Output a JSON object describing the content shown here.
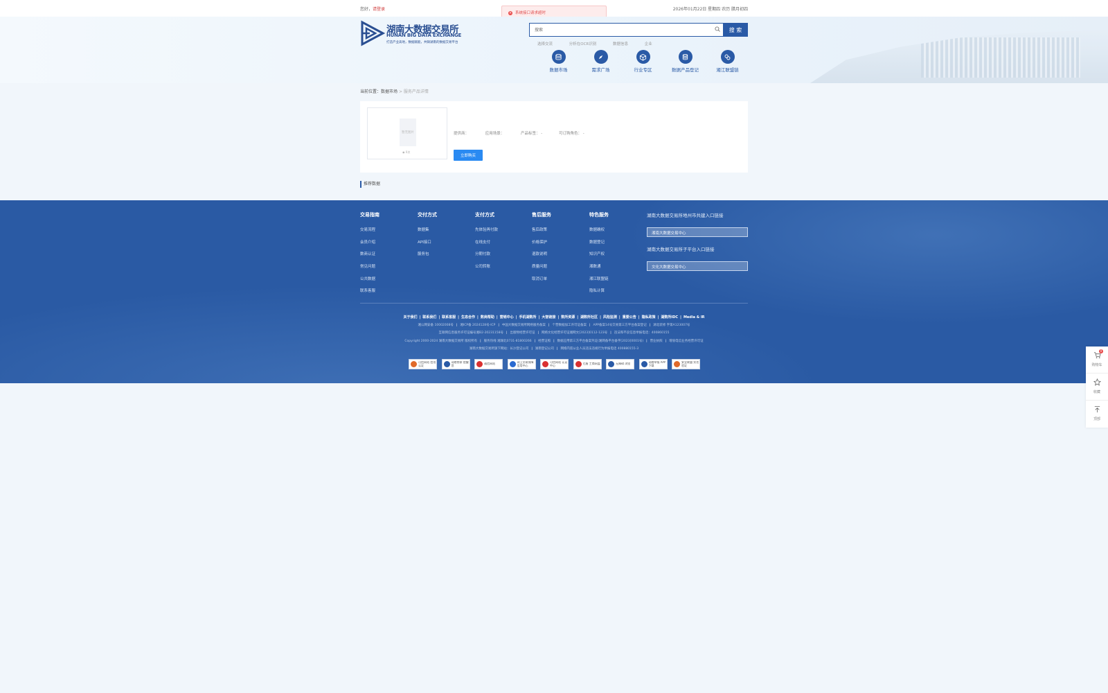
{
  "topbar": {
    "greeting": "您好，",
    "login": "请登录",
    "date": "2026年01月22日 星期四 农历 腊月初四"
  },
  "toast": {
    "message": "系统接口请求超时"
  },
  "logo": {
    "cn": "湖南大数据交易所",
    "en": "HUNAN BIG DATA EXCHANGE",
    "slogan": "打造产业高地，数据赋能，共铸湖南的数据交易平台"
  },
  "search": {
    "placeholder": "搜索",
    "button": "搜 索"
  },
  "hotwords": [
    "选择交流",
    "分析在OCR识别",
    "数据信息",
    "企业"
  ],
  "nav": [
    {
      "label": "数据市场",
      "icon": "database-icon"
    },
    {
      "label": "需求广场",
      "icon": "compass-icon"
    },
    {
      "label": "行业专区",
      "icon": "cube-icon"
    },
    {
      "label": "数据产品登记",
      "icon": "register-icon"
    },
    {
      "label": "湘江联盟链",
      "icon": "chain-icon"
    }
  ],
  "breadcrumb": {
    "prefix": "当前位置：",
    "market": "数据市场",
    "sep": " > ",
    "current": "服务产品详情"
  },
  "product": {
    "placeholder": "暂无图片",
    "views": "0次",
    "meta": [
      "提供商：",
      "应用场景：",
      "产品标签： -",
      "可订购角色： -"
    ],
    "buy": "立即购买"
  },
  "recommend": "推荐数据",
  "footer": {
    "columns": [
      {
        "title": "交易指南",
        "items": [
          "交易流程",
          "会员介绍",
          "数商认证",
          "常见问题",
          "公共数据",
          "联系客服"
        ]
      },
      {
        "title": "交付方式",
        "items": [
          "数据集",
          "API接口",
          "服务包"
        ]
      },
      {
        "title": "支付方式",
        "items": [
          "先体验再付款",
          "在线支付",
          "分期付款",
          "公司转账"
        ]
      },
      {
        "title": "售后服务",
        "items": [
          "售后政策",
          "价格保护",
          "退款说明",
          "质量问题",
          "取消订单"
        ]
      },
      {
        "title": "特色服务",
        "items": [
          "数据确权",
          "数据登记",
          "知识产权",
          "湘数通",
          "湘江联盟链",
          "隐私计算"
        ]
      }
    ],
    "portal1": {
      "title": "湖南大数据交易所地州市共建入口链接",
      "box": "湘南大数据交易中心"
    },
    "portal2": {
      "title": "湖南大数据交易所子平台入口链接",
      "box": "文化大数据交易中心"
    },
    "links": [
      "关于我们",
      "联系我们",
      "联系客服",
      "生态合作",
      "数商帮助",
      "营销中心",
      "手机湖数所",
      "大智链接",
      "数所资源",
      "湖数所社区",
      "风险监测",
      "重要公告",
      "隐私政策",
      "湖数所IDC",
      "Media & IR"
    ],
    "row1": [
      "湘公网安备 10002008号",
      "湘ICP备 2024128号-ICP",
      "中国大数据交易所网络服务备案",
      "个营数据加工许可证备案",
      "APP备案14号交易第三方平台备案登记",
      "湖北装修 字第A123007号"
    ],
    "row2": [
      "互联网信息服务许可证编号湘B2-20231158号",
      "出版物经营许可证",
      "网络文化经营许可证湘网文[2023]0112-123号",
      "违法和不良信息举报电话：400860155"
    ],
    "row3": [
      "Copyright 2000-2024 湖南大数据交易所 版权所有",
      "服务热线 湘湖北0731-81800266",
      "经营证照",
      "数据应用第三方平台备案凭证(湘网备平台备字[2023]0001号)",
      "营业执照",
      "增值电信业务经营许可证"
    ],
    "row4": [
      "湖南大数据交易所旗下网站：长沙登记公司",
      "湖南登记公司",
      "网络内容从业人员违法违规行为举报电话 400880155-3"
    ],
    "badges": [
      {
        "text": "可信网站 信用认证",
        "color": "#e06a2a"
      },
      {
        "text": "网络警察 提醒您",
        "color": "#2a5aa6"
      },
      {
        "text": "诚信网站",
        "color": "#d93030"
      },
      {
        "text": "网上交易保障 信用中心",
        "color": "#2a6ad0"
      },
      {
        "text": "可信网站 认证中心",
        "color": "#d93030"
      },
      {
        "text": "红盾 工商网监",
        "color": "#d93030"
      },
      {
        "text": "无障碍 浏览",
        "color": "#2a5aa6"
      },
      {
        "text": "网络举报 APP下载",
        "color": "#2a5aa6"
      },
      {
        "text": "安全联盟 实名验证",
        "color": "#e06a2a"
      }
    ]
  },
  "float": {
    "cart": "购物车",
    "cart_count": "0",
    "collect": "收藏",
    "top": "顶部"
  }
}
